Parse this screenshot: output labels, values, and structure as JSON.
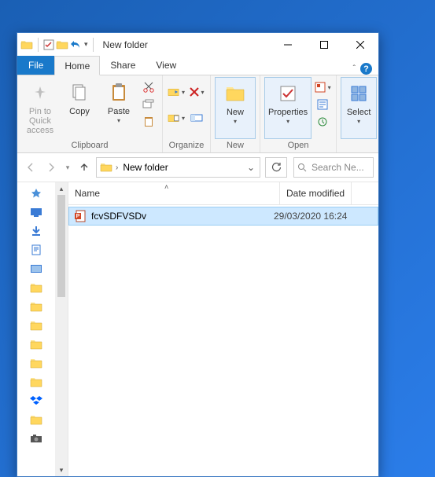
{
  "title": "New folder",
  "tabs": {
    "file": "File",
    "home": "Home",
    "share": "Share",
    "view": "View"
  },
  "ribbon": {
    "clipboard": {
      "label": "Clipboard",
      "pin": "Pin to Quick\naccess",
      "copy": "Copy",
      "paste": "Paste"
    },
    "organize": {
      "label": "Organize"
    },
    "new": {
      "label": "New",
      "btn": "New"
    },
    "open": {
      "label": "Open",
      "props": "Properties"
    },
    "select": {
      "label": "Select",
      "btn": "Select"
    }
  },
  "breadcrumb": {
    "current": "New folder"
  },
  "search": {
    "placeholder": "Search Ne..."
  },
  "columns": {
    "name": "Name",
    "date": "Date modified"
  },
  "rows": [
    {
      "name": "fcvSDFVSDv",
      "date": "29/03/2020 16:24",
      "type": "pptx"
    }
  ]
}
